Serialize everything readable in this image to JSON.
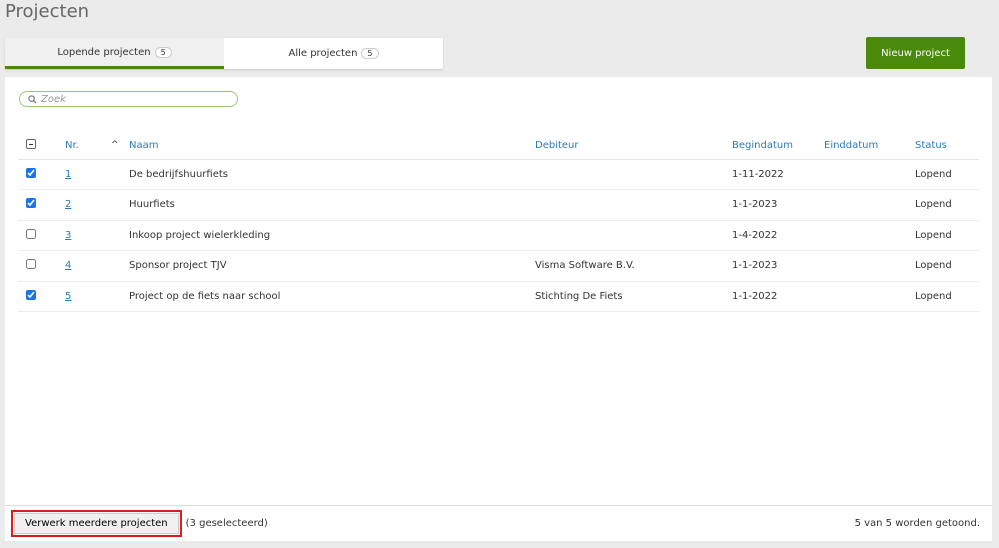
{
  "page": {
    "title": "Projecten"
  },
  "tabs": [
    {
      "label": "Lopende projecten",
      "count": "5"
    },
    {
      "label": "Alle projecten",
      "count": "5"
    }
  ],
  "new_button": "Nieuw project",
  "search": {
    "placeholder": "Zoek"
  },
  "columns": {
    "nr": "Nr.",
    "naam": "Naam",
    "debiteur": "Debiteur",
    "begindatum": "Begindatum",
    "einddatum": "Einddatum",
    "status": "Status"
  },
  "rows": [
    {
      "checked": true,
      "nr": "1",
      "naam": "De bedrijfshuurfiets",
      "debiteur": "",
      "begindatum": "1-11-2022",
      "einddatum": "",
      "status": "Lopend"
    },
    {
      "checked": true,
      "nr": "2",
      "naam": "Huurfiets",
      "debiteur": "",
      "begindatum": "1-1-2023",
      "einddatum": "",
      "status": "Lopend"
    },
    {
      "checked": false,
      "nr": "3",
      "naam": "Inkoop project wielerkleding",
      "debiteur": "",
      "begindatum": "1-4-2022",
      "einddatum": "",
      "status": "Lopend"
    },
    {
      "checked": false,
      "nr": "4",
      "naam": "Sponsor project TJV",
      "debiteur": "Visma Software B.V.",
      "begindatum": "1-1-2023",
      "einddatum": "",
      "status": "Lopend"
    },
    {
      "checked": true,
      "nr": "5",
      "naam": "Project op de fiets naar school",
      "debiteur": "Stichting De Fiets",
      "begindatum": "1-1-2022",
      "einddatum": "",
      "status": "Lopend"
    }
  ],
  "footer": {
    "bulk_button": "Verwerk meerdere projecten",
    "selected": "(3 geselecteerd)",
    "count": "5 van 5 worden getoond."
  }
}
